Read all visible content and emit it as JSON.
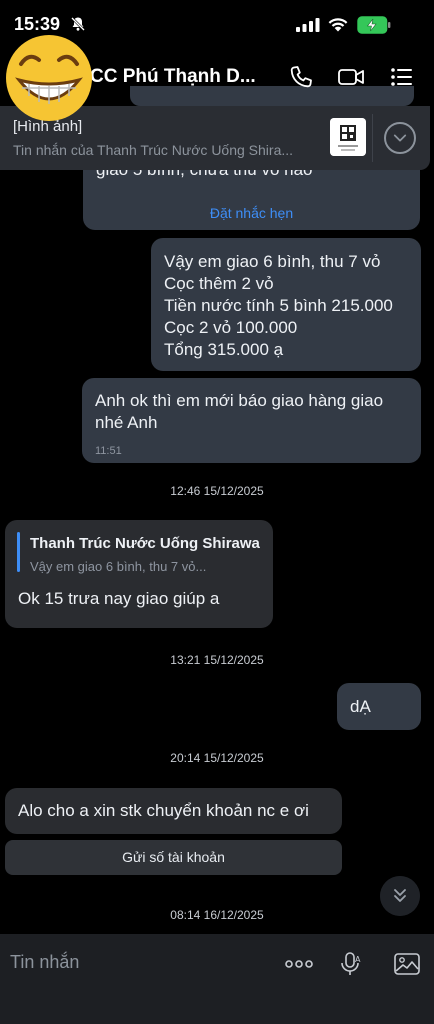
{
  "status_bar": {
    "time": "15:39"
  },
  "header": {
    "title": "CC Phú Thạnh D..."
  },
  "pinned": {
    "label": "[Hình ảnh]",
    "subtitle": "Tin nhắn của Thanh Trúc Nước Uống Shira..."
  },
  "messages": {
    "m1_fragment": "giao 5 bình, chưa thu vỏ nào",
    "m1_action": "Đặt nhắc hẹn",
    "m2_lines": [
      "Vậy em giao 6 bình, thu 7 vỏ",
      "Cọc thêm 2 vỏ",
      "Tiền nước tính 5 bình 215.000",
      "Cọc 2 vỏ 100.000",
      "Tổng 315.000 ạ"
    ],
    "m3_text_line1": "Anh ok thì em mới báo giao hàng giao",
    "m3_text_line2": "nhé Anh",
    "m3_time": "11:51",
    "divider1": "12:46 15/12/2025",
    "m4_reply_name": "Thanh Trúc Nước Uống Shirawa",
    "m4_reply_preview": "Vậy em giao 6 bình, thu 7 vỏ...",
    "m4_text": "Ok 15 trưa nay giao giúp a",
    "divider2": "13:21 15/12/2025",
    "m5_text": "dẠ",
    "divider3": "20:14 15/12/2025",
    "m6_text": "Alo cho a xin stk chuyển khoản nc e ơi",
    "m6_button": "Gửi số tài khoản",
    "divider4": "08:14 16/12/2025"
  },
  "input": {
    "placeholder": "Tin nhắn"
  }
}
